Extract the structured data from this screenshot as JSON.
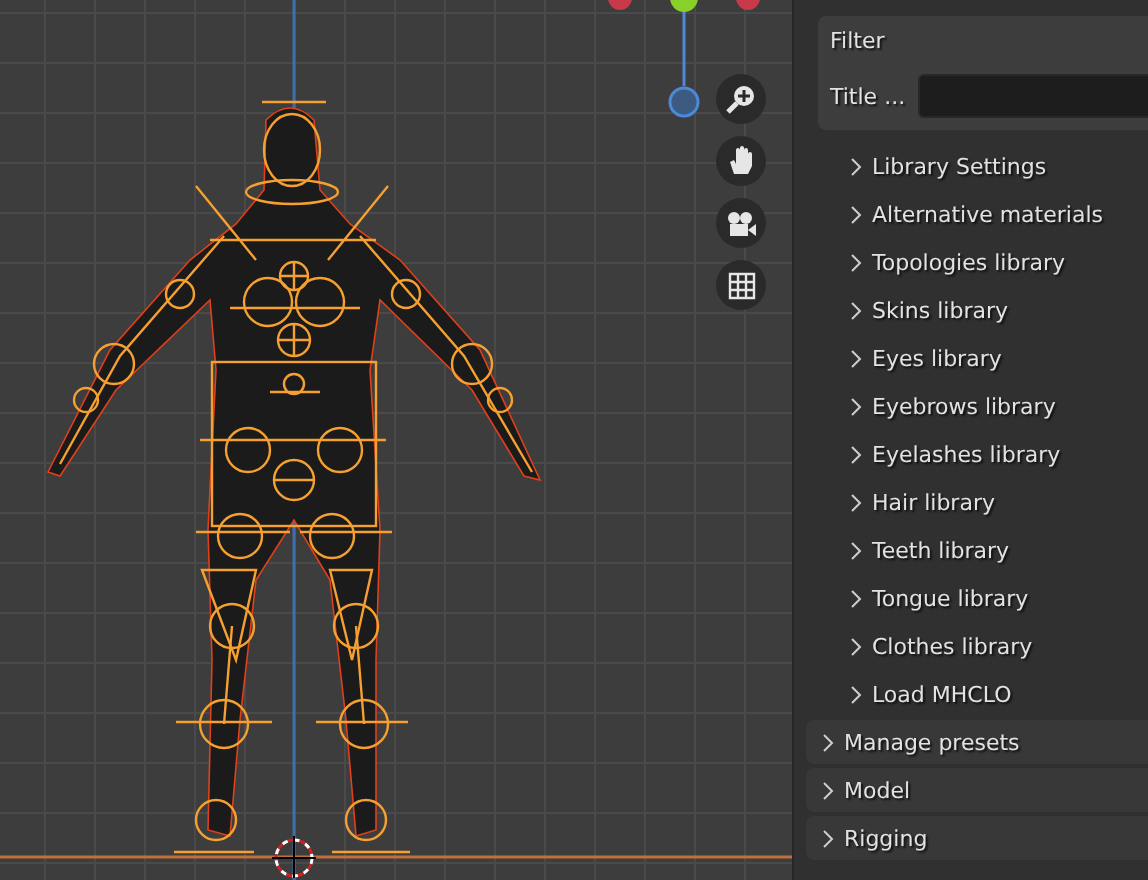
{
  "viewport": {
    "nav_buttons": [
      {
        "kind": "zoom"
      },
      {
        "kind": "pan"
      },
      {
        "kind": "camera"
      },
      {
        "kind": "grid"
      }
    ]
  },
  "filter_panel": {
    "title": "Filter",
    "field_label": "Title ..."
  },
  "subpanels": [
    {
      "label": "Library Settings",
      "expanded": false
    },
    {
      "label": "Alternative materials",
      "expanded": false
    },
    {
      "label": "Topologies library",
      "expanded": false
    },
    {
      "label": "Skins library",
      "expanded": false
    },
    {
      "label": "Eyes library",
      "expanded": false
    },
    {
      "label": "Eyebrows library",
      "expanded": false
    },
    {
      "label": "Eyelashes library",
      "expanded": false
    },
    {
      "label": "Hair library",
      "expanded": false
    },
    {
      "label": "Teeth library",
      "expanded": false
    },
    {
      "label": "Tongue library",
      "expanded": false
    },
    {
      "label": "Clothes library",
      "expanded": false
    },
    {
      "label": "Load MHCLO",
      "expanded": false
    }
  ],
  "panels": [
    {
      "label": "Manage presets",
      "expanded": false
    },
    {
      "label": "Model",
      "expanded": false
    },
    {
      "label": "Rigging",
      "expanded": false
    }
  ]
}
